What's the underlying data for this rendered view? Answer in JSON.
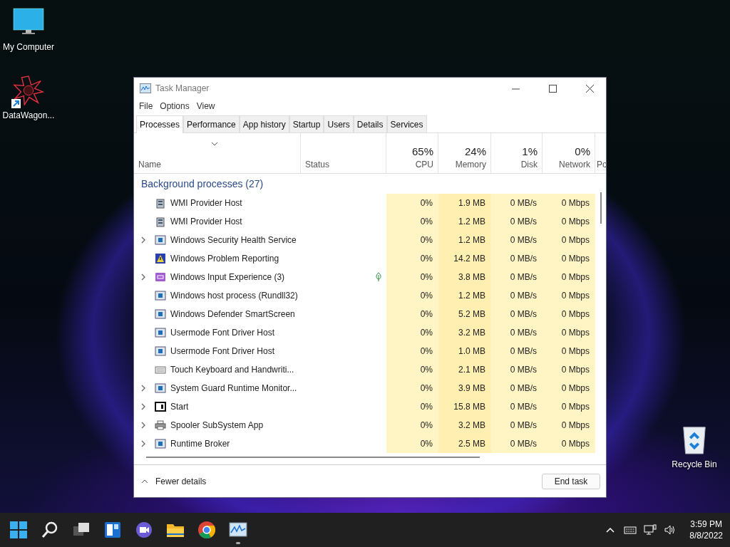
{
  "desktop_icons": [
    {
      "label": "My Computer",
      "kind": "computer",
      "shortcut": false
    },
    {
      "label": "DataWagon...",
      "kind": "star",
      "shortcut": true
    },
    {
      "label": "Recycle Bin",
      "kind": "recycle",
      "shortcut": false
    }
  ],
  "window": {
    "title": "Task Manager",
    "menu": [
      "File",
      "Options",
      "View"
    ],
    "tabs": [
      {
        "label": "Processes",
        "selected": true
      },
      {
        "label": "Performance",
        "selected": false
      },
      {
        "label": "App history",
        "selected": false
      },
      {
        "label": "Startup",
        "selected": false
      },
      {
        "label": "Users",
        "selected": false
      },
      {
        "label": "Details",
        "selected": false
      },
      {
        "label": "Services",
        "selected": false
      }
    ],
    "name_header": "Name",
    "status_header": "Status",
    "metrics": [
      {
        "total": "65%",
        "label": "CPU"
      },
      {
        "total": "24%",
        "label": "Memory"
      },
      {
        "total": "1%",
        "label": "Disk"
      },
      {
        "total": "0%",
        "label": "Network"
      }
    ],
    "column_7": "Po",
    "group": "Background processes (27)",
    "rows": [
      {
        "name": "WMI Provider Host",
        "kind": "wmi",
        "expandable": false,
        "efficiency": false,
        "cpu": "0%",
        "memory": "1.9 MB",
        "disk": "0 MB/s",
        "network": "0 Mbps"
      },
      {
        "name": "WMI Provider Host",
        "kind": "wmi",
        "expandable": false,
        "efficiency": false,
        "cpu": "0%",
        "memory": "1.2 MB",
        "disk": "0 MB/s",
        "network": "0 Mbps"
      },
      {
        "name": "Windows Security Health Service",
        "kind": "app",
        "expandable": true,
        "efficiency": false,
        "cpu": "0%",
        "memory": "1.2 MB",
        "disk": "0 MB/s",
        "network": "0 Mbps"
      },
      {
        "name": "Windows Problem Reporting",
        "kind": "problem",
        "expandable": false,
        "efficiency": false,
        "cpu": "0%",
        "memory": "14.2 MB",
        "disk": "0 MB/s",
        "network": "0 Mbps"
      },
      {
        "name": "Windows Input Experience (3)",
        "kind": "input",
        "expandable": true,
        "efficiency": true,
        "cpu": "0%",
        "memory": "3.8 MB",
        "disk": "0 MB/s",
        "network": "0 Mbps"
      },
      {
        "name": "Windows host process (Rundll32)",
        "kind": "app",
        "expandable": false,
        "efficiency": false,
        "cpu": "0%",
        "memory": "1.2 MB",
        "disk": "0 MB/s",
        "network": "0 Mbps"
      },
      {
        "name": "Windows Defender SmartScreen",
        "kind": "app",
        "expandable": false,
        "efficiency": false,
        "cpu": "0%",
        "memory": "5.2 MB",
        "disk": "0 MB/s",
        "network": "0 Mbps"
      },
      {
        "name": "Usermode Font Driver Host",
        "kind": "app",
        "expandable": false,
        "efficiency": false,
        "cpu": "0%",
        "memory": "3.2 MB",
        "disk": "0 MB/s",
        "network": "0 Mbps"
      },
      {
        "name": "Usermode Font Driver Host",
        "kind": "app",
        "expandable": false,
        "efficiency": false,
        "cpu": "0%",
        "memory": "1.0 MB",
        "disk": "0 MB/s",
        "network": "0 Mbps"
      },
      {
        "name": "Touch Keyboard and Handwriti...",
        "kind": "keyboard",
        "expandable": false,
        "efficiency": false,
        "cpu": "0%",
        "memory": "2.1 MB",
        "disk": "0 MB/s",
        "network": "0 Mbps"
      },
      {
        "name": "System Guard Runtime Monitor...",
        "kind": "app",
        "expandable": true,
        "efficiency": false,
        "cpu": "0%",
        "memory": "3.9 MB",
        "disk": "0 MB/s",
        "network": "0 Mbps"
      },
      {
        "name": "Start",
        "kind": "start",
        "expandable": true,
        "efficiency": false,
        "cpu": "0%",
        "memory": "15.8 MB",
        "disk": "0 MB/s",
        "network": "0 Mbps"
      },
      {
        "name": "Spooler SubSystem App",
        "kind": "printer",
        "expandable": true,
        "efficiency": false,
        "cpu": "0%",
        "memory": "3.2 MB",
        "disk": "0 MB/s",
        "network": "0 Mbps"
      },
      {
        "name": "Runtime Broker",
        "kind": "app",
        "expandable": true,
        "efficiency": false,
        "cpu": "0%",
        "memory": "2.5 MB",
        "disk": "0 MB/s",
        "network": "0 Mbps"
      }
    ],
    "footer_toggle": "Fewer details",
    "end_task": "End task"
  },
  "taskbar": {
    "apps": [
      {
        "kind": "start",
        "running": false
      },
      {
        "kind": "search",
        "running": false
      },
      {
        "kind": "taskview",
        "running": false
      },
      {
        "kind": "widgets",
        "running": false
      },
      {
        "kind": "chat",
        "running": false
      },
      {
        "kind": "folder",
        "running": false
      },
      {
        "kind": "browser",
        "running": false
      },
      {
        "kind": "taskmgr",
        "running": true
      }
    ],
    "time": "3:59 PM",
    "date": "8/8/2022"
  }
}
